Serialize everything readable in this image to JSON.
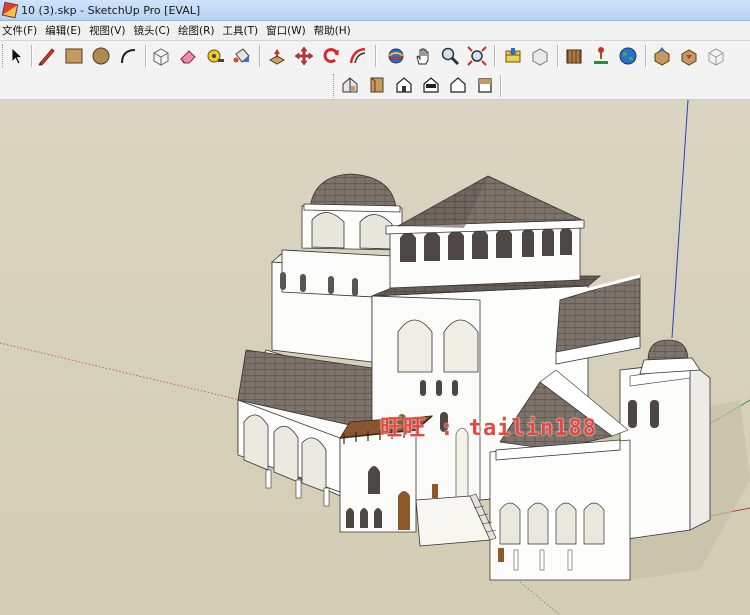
{
  "window": {
    "title": "10 (3).skp - SketchUp Pro [EVAL]"
  },
  "menu": [
    "文件(F)",
    "编辑(E)",
    "视图(V)",
    "镜头(C)",
    "绘图(R)",
    "工具(T)",
    "窗口(W)",
    "帮助(H)"
  ],
  "toolbar": {
    "main_tools": [
      "select-arrow-icon",
      "pencil-line-icon",
      "rectangle-icon",
      "circle-icon",
      "arc-icon",
      "make-component-icon",
      "eraser-icon",
      "tape-measure-icon",
      "paint-bucket-icon",
      "push-pull-icon",
      "move-icon",
      "rotate-icon",
      "offset-icon",
      "orbit-icon",
      "pan-hand-icon",
      "zoom-icon",
      "zoom-extents-icon",
      "get-models-icon",
      "share-model-icon",
      "share-component-icon",
      "photo-textures-icon",
      "add-location-icon",
      "geo-globe-icon",
      "warehouse-up-icon",
      "warehouse-down-icon",
      "extension-icon"
    ],
    "view_tools": [
      "iso-view-icon",
      "top-view-icon",
      "front-view-icon",
      "right-view-icon",
      "back-view-icon",
      "left-view-icon"
    ]
  },
  "viewport": {
    "watermark": "旺旺 : tailin188",
    "colors": {
      "ground": "#d6d1bb",
      "wall": "#fdfdfb",
      "roof": "#7a7068",
      "axis_blue": "#2d3fbf",
      "axis_red": "#c23b3b",
      "axis_green": "#3c9a3c"
    }
  }
}
